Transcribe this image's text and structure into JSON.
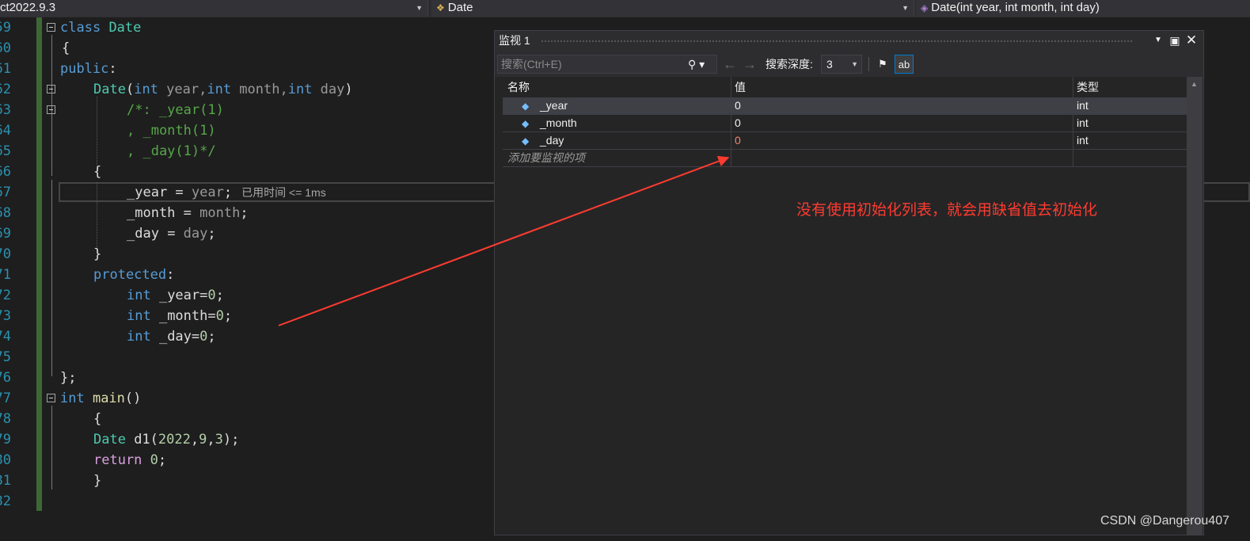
{
  "navbar": {
    "project": "ct2022.9.3",
    "scope": "Date",
    "member": "Date(int year, int month, int day)"
  },
  "editor": {
    "line_numbers": [
      "59",
      "60",
      "61",
      "62",
      "63",
      "64",
      "65",
      "66",
      "67",
      "68",
      "69",
      "70",
      "71",
      "72",
      "73",
      "74",
      "75",
      "76",
      "77",
      "78",
      "79",
      "80",
      "81",
      "82"
    ],
    "perf_tip": "已用时间 <= 1ms",
    "lines": {
      "class_kw": "class",
      "class_name": "Date",
      "open1": "{",
      "public_kw": "public",
      "colon": ":",
      "ctor_name": "Date",
      "ctor_paren_open": "(",
      "int1": "int",
      "p_year": " year,",
      "int2": "int",
      "p_month": " month,",
      "int3": "int",
      "p_day": " day",
      "ctor_paren_close": ")",
      "cm1": "/*: _year(1)",
      "cm2": ", _month(1)",
      "cm3": ", _day(1)*/",
      "open2": "{",
      "asg1_lhs": "_year",
      "asg1_eq": " = ",
      "asg1_rhs": "year",
      "semi": ";",
      "asg2_lhs": "_month",
      "asg2_rhs": "month",
      "asg3_lhs": "_day",
      "asg3_rhs": "day",
      "close2": "}",
      "protected_kw": "protected",
      "f1_int": "int",
      "f1": " _year=",
      "f1v": "0",
      "f2_int": "int",
      "f2": " _month=",
      "f2v": "0",
      "f3_int": "int",
      "f3": " _day=",
      "f3v": "0",
      "close_class": "};",
      "main_int": "int",
      "main_name": " main",
      "main_paren": "()",
      "open3": "{",
      "d1_type": "Date",
      "d1_name": " d1",
      "d1_open": "(",
      "d1_a": "2022",
      "d1_comma": ",",
      "d1_b": "9",
      "d1_c": "3",
      "d1_close": ");",
      "ret_kw": "return",
      "ret_val": "0",
      "close3": "}"
    }
  },
  "watch": {
    "title": "监视 1",
    "search_placeholder": "搜索(Ctrl+E)",
    "depth_label": "搜索深度:",
    "depth_value": "3",
    "columns": {
      "name": "名称",
      "value": "值",
      "type": "类型"
    },
    "rows": [
      {
        "name": "_year",
        "value": "0",
        "type": "int"
      },
      {
        "name": "_month",
        "value": "0",
        "type": "int"
      },
      {
        "name": "_day",
        "value": "0",
        "type": "int"
      }
    ],
    "add_item": "添加要监视的项"
  },
  "annotation": "没有使用初始化列表，就会用缺省值去初始化",
  "watermark": "CSDN @Dangerou407",
  "colors": {
    "accent": "#007acc",
    "annotation": "#ff3b30",
    "keyword": "#569cd6",
    "type": "#4ec9b0",
    "comment": "#57a64a"
  }
}
